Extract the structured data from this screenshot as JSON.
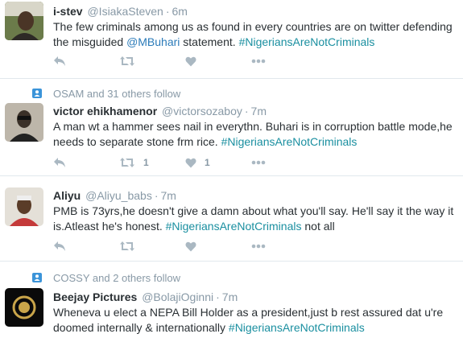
{
  "colors": {
    "link": "#2b7bb9",
    "hashtag": "#1a8fa0",
    "meta": "#8899a6",
    "icon": "#aab8c2",
    "context_icon_bg": "#3b94d9"
  },
  "tweets": [
    {
      "context": "",
      "name": "i-stev",
      "handle": "@IsiakaSteven",
      "time": "6m",
      "text_before": "The few criminals among us as found in every countries are on twitter defending the misguided ",
      "mention": "@MBuhari",
      "text_mid": " statement. ",
      "hashtag": "#NigeriansAreNotCriminals",
      "text_after": "",
      "retweets": "",
      "likes": "",
      "avatar_icon": "user-photo-icon"
    },
    {
      "context": "OSAM and 31 others follow",
      "name": "victor ehikhamenor",
      "handle": "@victorsozaboy",
      "time": "7m",
      "text_before": "A man wt a hammer sees nail in everythn. Buhari is in corruption battle mode,he needs to separate stone frm rice. ",
      "mention": "",
      "text_mid": "",
      "hashtag": "#NigeriansAreNotCriminals",
      "text_after": "",
      "retweets": "1",
      "likes": "1",
      "avatar_icon": "user-photo-icon"
    },
    {
      "context": "",
      "name": "Aliyu",
      "handle": "@Aliyu_babs",
      "time": "7m",
      "text_before": "PMB is 73yrs,he doesn't give a damn about what you'll say. He'll say it the way it is.Atleast he's honest. ",
      "mention": "",
      "text_mid": "",
      "hashtag": "#NigeriansAreNotCriminals",
      "text_after": " not all",
      "retweets": "",
      "likes": "",
      "avatar_icon": "user-photo-icon"
    },
    {
      "context": "COSSY and 2 others follow",
      "name": "Beejay Pictures",
      "handle": "@BolajiOginni",
      "time": "7m",
      "text_before": "Wheneva u elect a NEPA Bill Holder as a president,just b rest assured dat u're doomed internally & internationally ",
      "mention": "",
      "text_mid": "",
      "hashtag": "#NigeriansAreNotCriminals",
      "text_after": "",
      "retweets": "",
      "likes": "",
      "avatar_icon": "brand-logo-icon"
    }
  ]
}
